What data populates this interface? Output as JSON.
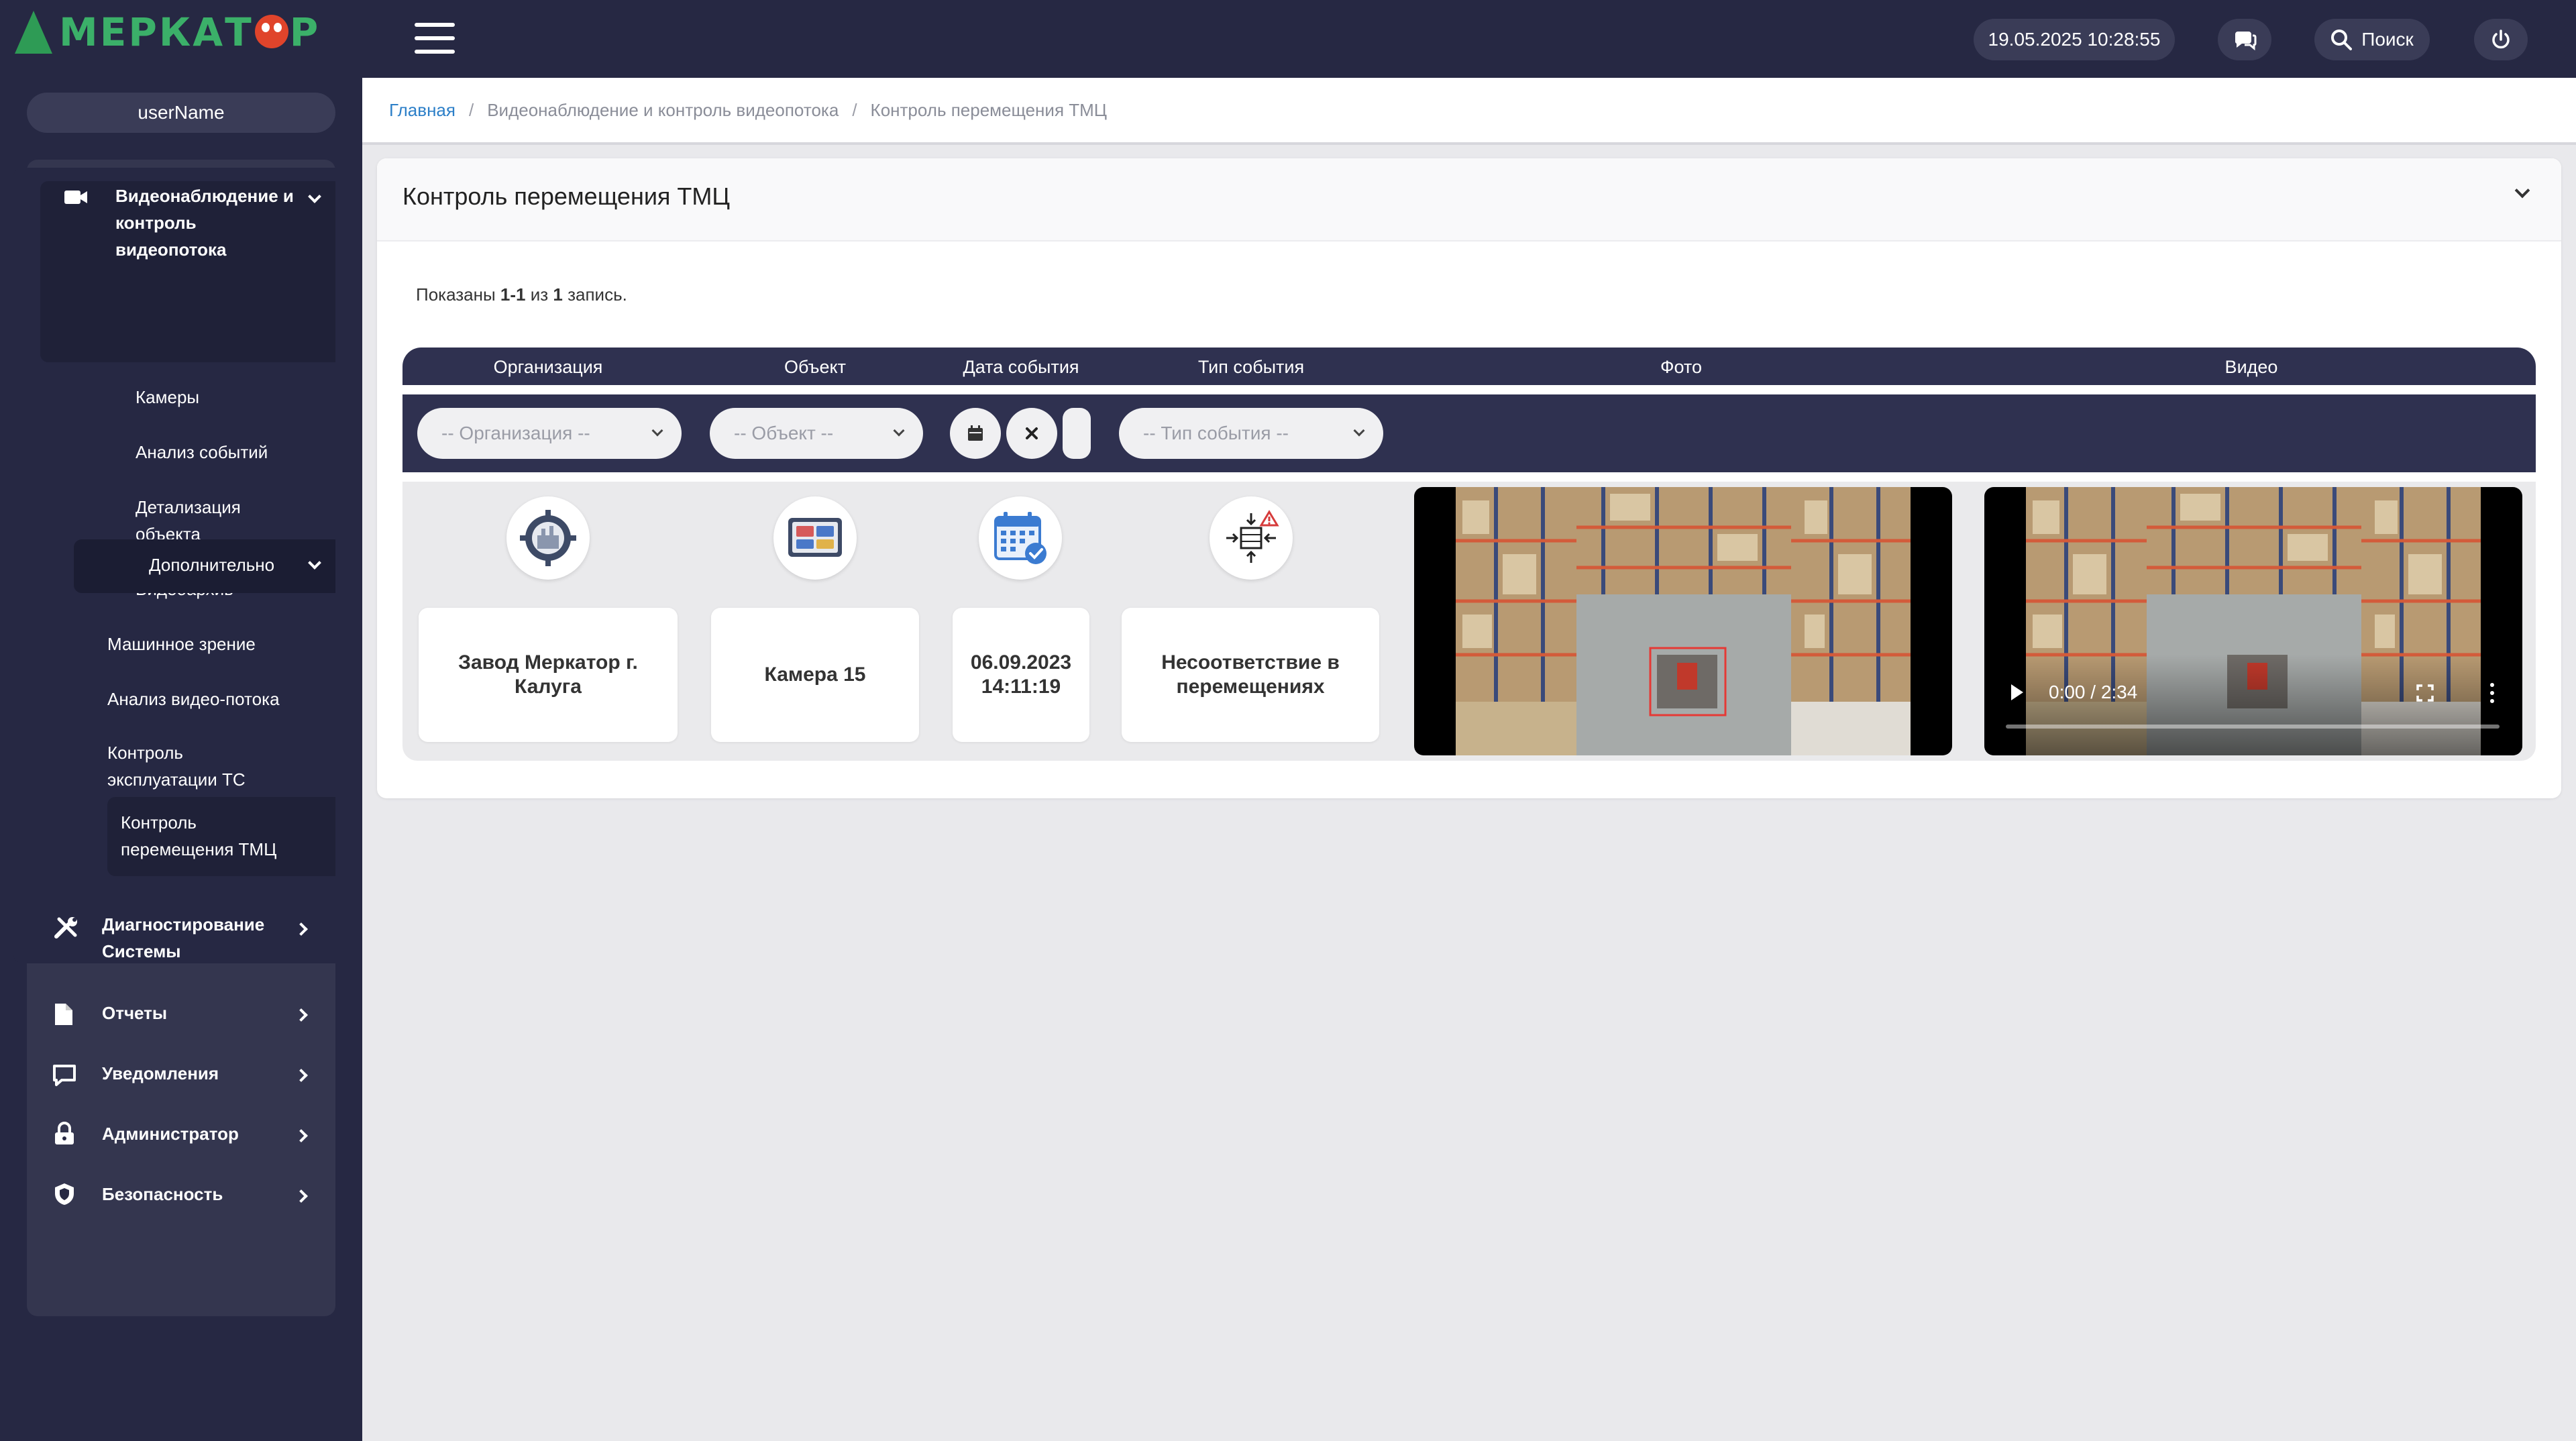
{
  "header": {
    "brand": "МЕРКАТОР",
    "datetime": "19.05.2025 10:28:55",
    "search_label": "Поиск"
  },
  "sidebar": {
    "username": "userName",
    "sections": [
      {
        "label": "Видеонаблюдение и контроль видеопотока",
        "icon": "video-camera-icon",
        "expanded": true,
        "items": [
          "Камеры",
          "Анализ событий",
          "Детализация объекта",
          "Видеоархив"
        ],
        "more": {
          "label": "Дополнительно",
          "expanded": true,
          "items": [
            "Машинное зрение",
            "Анализ видео-потока",
            "Контроль эксплуатации ТС",
            "Контроль перемещения ТМЦ"
          ]
        }
      },
      {
        "label": "Диагностирование Системы",
        "icon": "tools-icon"
      },
      {
        "label": "Отчеты",
        "icon": "document-icon"
      },
      {
        "label": "Уведомления",
        "icon": "message-icon"
      },
      {
        "label": "Администратор",
        "icon": "lock-icon"
      },
      {
        "label": "Безопасность",
        "icon": "shield-icon"
      }
    ]
  },
  "breadcrumb": [
    "Главная",
    "Видеонаблюдение и контроль видеопотока",
    "Контроль перемещения ТМЦ"
  ],
  "panel": {
    "title": "Контроль перемещения ТМЦ",
    "summary_prefix": "Показаны ",
    "summary_range": "1-1",
    "summary_mid": " из ",
    "summary_total": "1",
    "summary_suffix": " запись."
  },
  "table": {
    "columns": [
      "Организация",
      "Объект",
      "Дата события",
      "Тип события",
      "Фото",
      "Видео"
    ],
    "filters": {
      "organization_placeholder": "-- Организация --",
      "object_placeholder": "-- Объект --",
      "event_type_placeholder": "-- Тип события --"
    },
    "rows": [
      {
        "organization": "Завод Меркатор г. Калуга",
        "object": "Камера 15",
        "date": "06.09.2023 14:11:19",
        "event_type": "Несоответствие в перемещениях",
        "video_time": "0:00 / 2:34"
      }
    ]
  },
  "colors": {
    "header_bg": "#262843",
    "table_header_bg": "#2f3150",
    "brand_green": "#3bb069",
    "link_blue": "#2c7fc8"
  }
}
